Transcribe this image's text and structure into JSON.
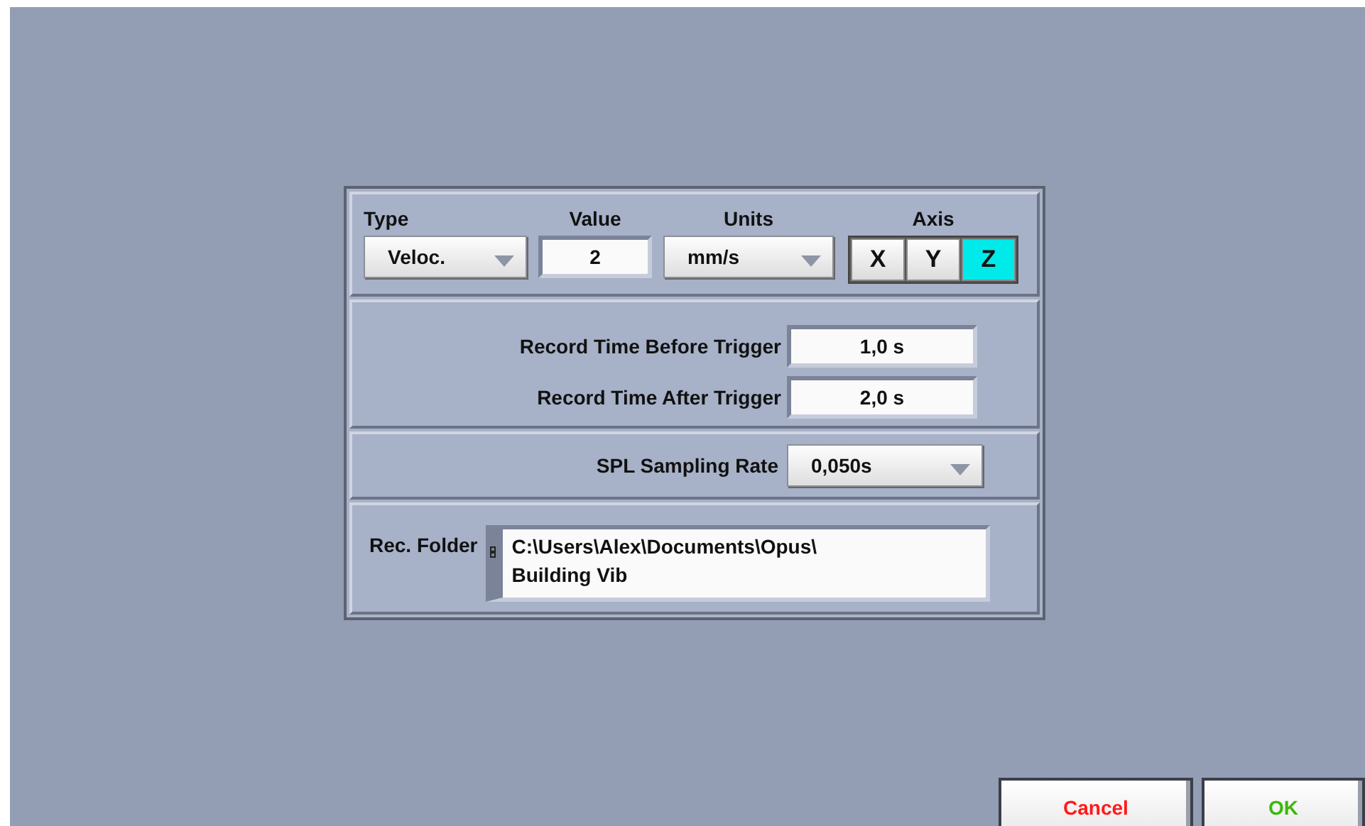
{
  "type_selector": {
    "label": "Type",
    "value": "Veloc."
  },
  "value_field": {
    "label": "Value",
    "value": "2"
  },
  "units_selector": {
    "label": "Units",
    "value": "mm/s"
  },
  "axis": {
    "label": "Axis",
    "options": [
      {
        "label": "X",
        "selected": false
      },
      {
        "label": "Y",
        "selected": false
      },
      {
        "label": "Z",
        "selected": true
      }
    ]
  },
  "record_times": [
    {
      "label": "Record Time Before Trigger",
      "value": "1,0 s"
    },
    {
      "label": "Record Time After Trigger",
      "value": "2,0 s"
    }
  ],
  "spl_sampling_rate": {
    "label": "SPL Sampling Rate",
    "value": "0,050s"
  },
  "rec_folder": {
    "label": "Rec. Folder",
    "value": "C:\\Users\\Alex\\Documents\\Opus\\Building Vib"
  },
  "buttons": [
    {
      "label": "Cancel",
      "kind": "cancel"
    },
    {
      "label": "OK",
      "kind": "confirm"
    }
  ]
}
